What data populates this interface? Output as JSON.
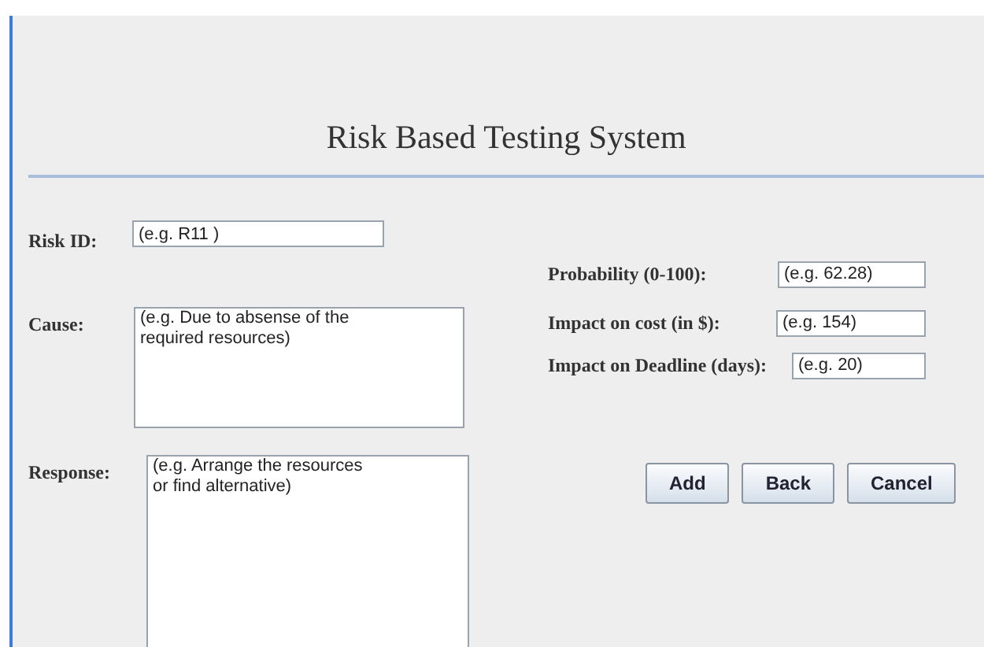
{
  "title": "Risk Based Testing System",
  "left_fields": [
    {
      "label": "Risk ID:",
      "kind": "line",
      "value": "(e.g. R11 )"
    },
    {
      "label": "Cause:",
      "kind": "area",
      "value": "(e.g. Due to absense of the\nrequired resources)"
    },
    {
      "label": "Response:",
      "kind": "area",
      "value": "(e.g. Arrange the resources\nor find alternative)"
    }
  ],
  "right_fields": [
    {
      "label": "Probability (0-100):",
      "value": "(e.g. 62.28)"
    },
    {
      "label": "Impact on cost (in $):",
      "value": "(e.g. 154)"
    },
    {
      "label": "Impact on Deadline (days):",
      "value": "(e.g. 20)"
    }
  ],
  "buttons": [
    "Add",
    "Back",
    "Cancel"
  ]
}
